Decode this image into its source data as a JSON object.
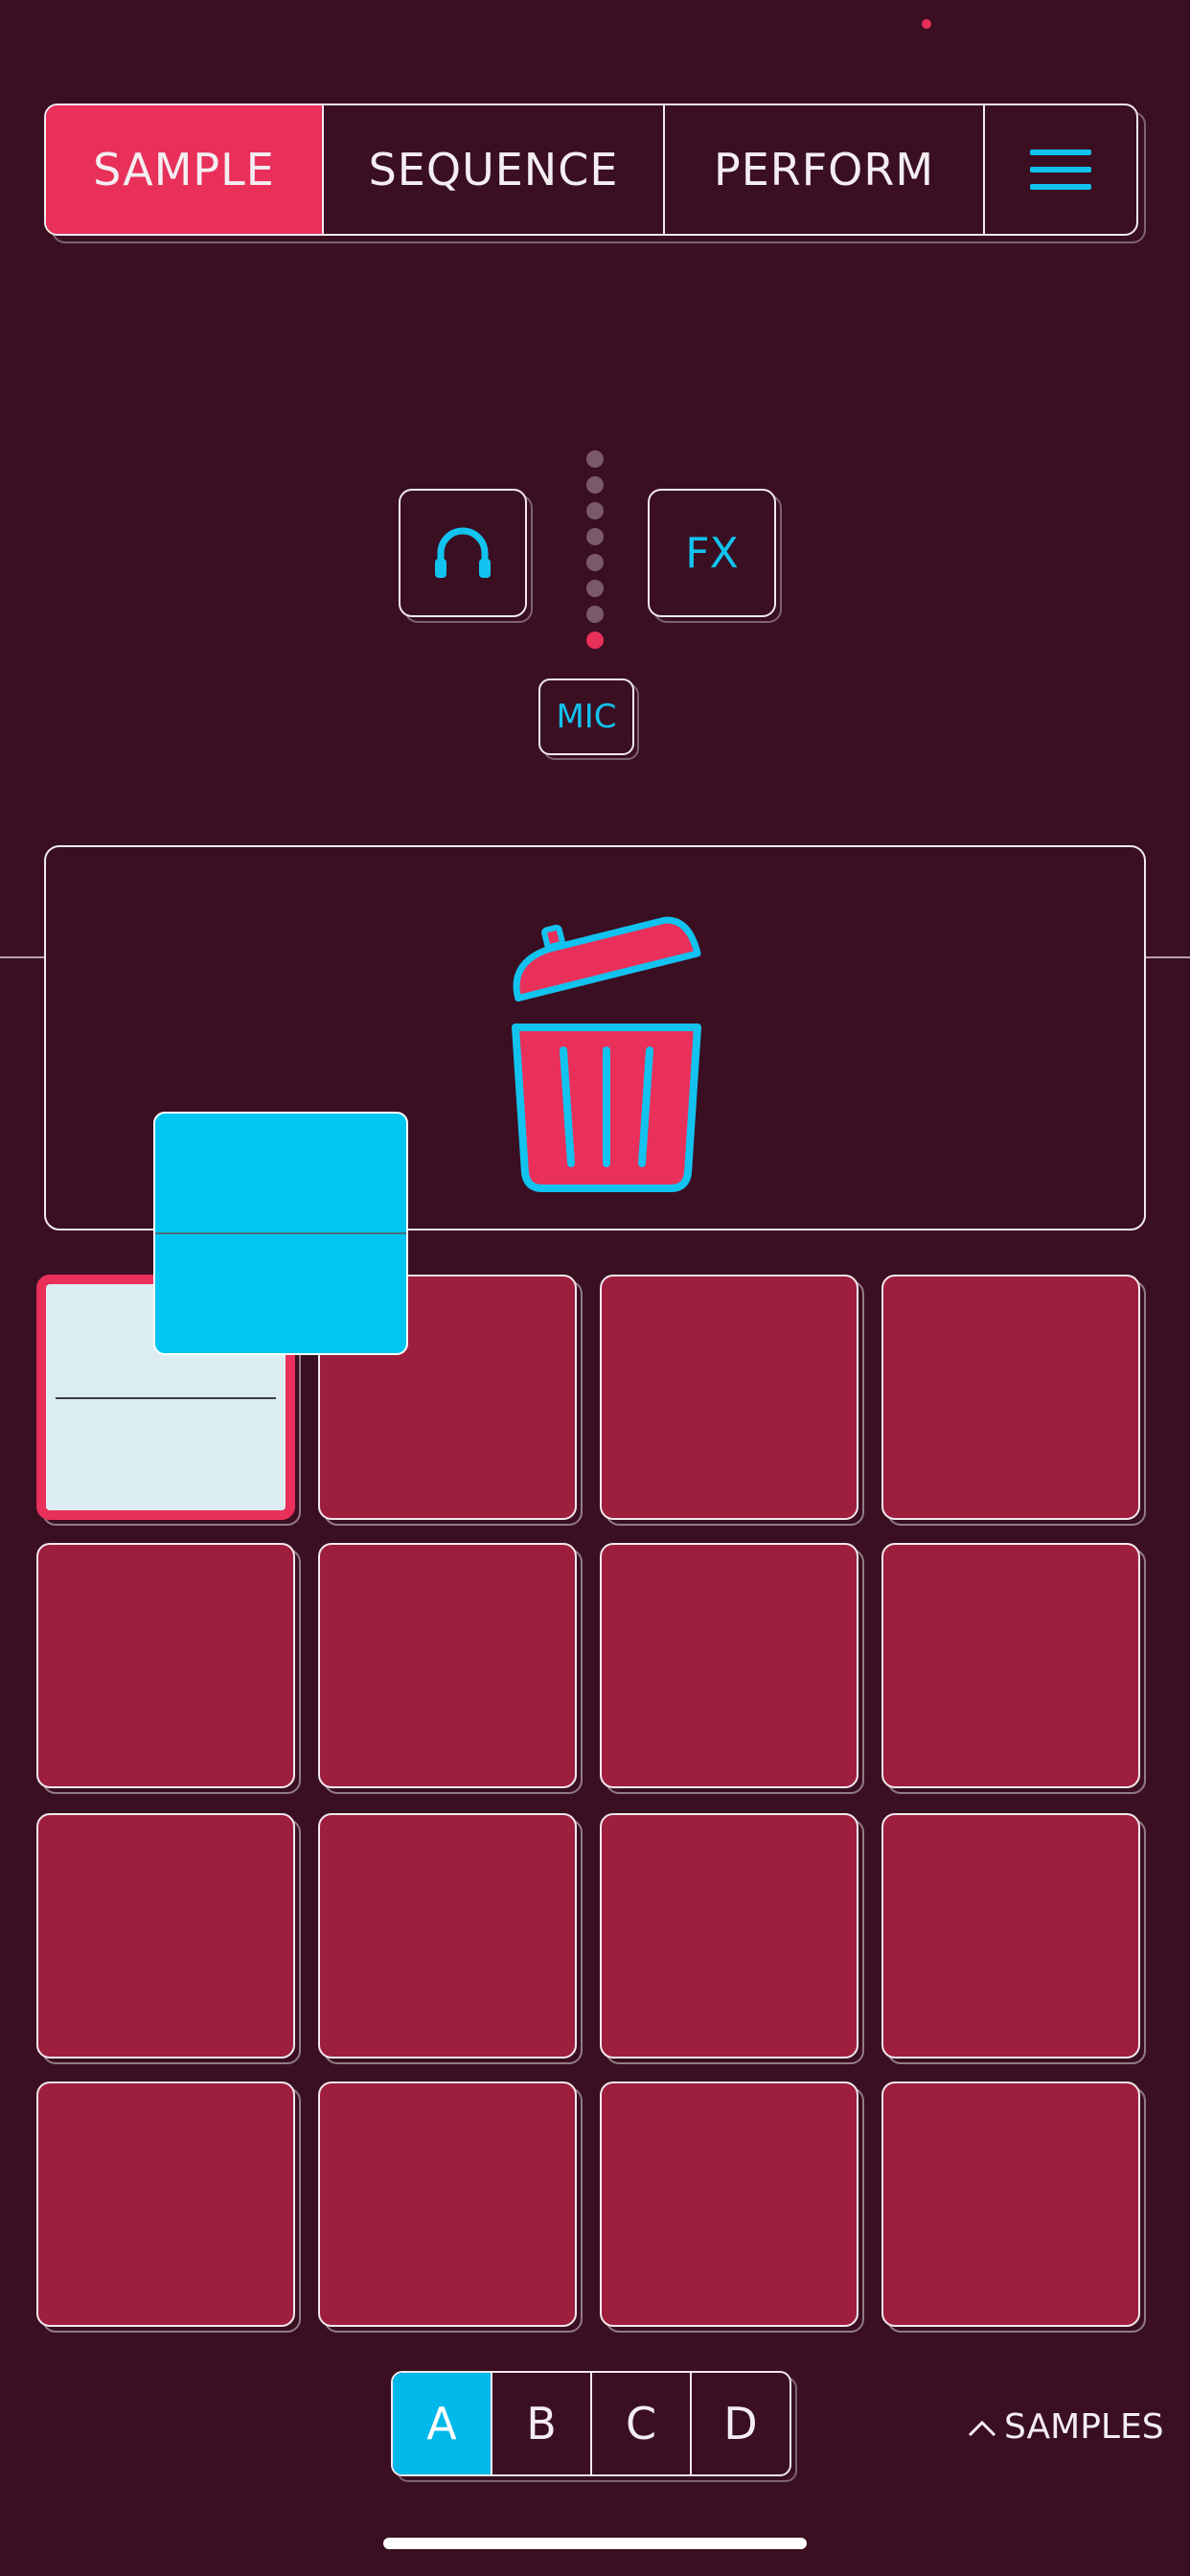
{
  "tabs": [
    {
      "label": "SAMPLE",
      "active": true
    },
    {
      "label": "SEQUENCE",
      "active": false
    },
    {
      "label": "PERFORM",
      "active": false
    }
  ],
  "menu_icon": "hamburger-menu-icon",
  "monitor_button": {
    "icon": "headphones-icon"
  },
  "fx_button": {
    "label": "FX"
  },
  "mic_button": {
    "label": "MIC"
  },
  "input_level": {
    "segments": 8,
    "lit": 1
  },
  "trash_zone": {
    "icon": "trash-can-icon"
  },
  "pads": {
    "rows": 4,
    "cols": 4,
    "selected_index": 0,
    "loaded_index": 0
  },
  "dragged_sample": {
    "icon": "waveform"
  },
  "banks": [
    {
      "label": "A",
      "active": true
    },
    {
      "label": "B",
      "active": false
    },
    {
      "label": "C",
      "active": false
    },
    {
      "label": "D",
      "active": false
    }
  ],
  "samples_link": {
    "label": "SAMPLES",
    "icon": "chevron-up-icon"
  },
  "colors": {
    "background": "#3a0f22",
    "accent_red": "#e8305a",
    "accent_cyan": "#0fc2ee",
    "pad": "#9e1f3d"
  }
}
